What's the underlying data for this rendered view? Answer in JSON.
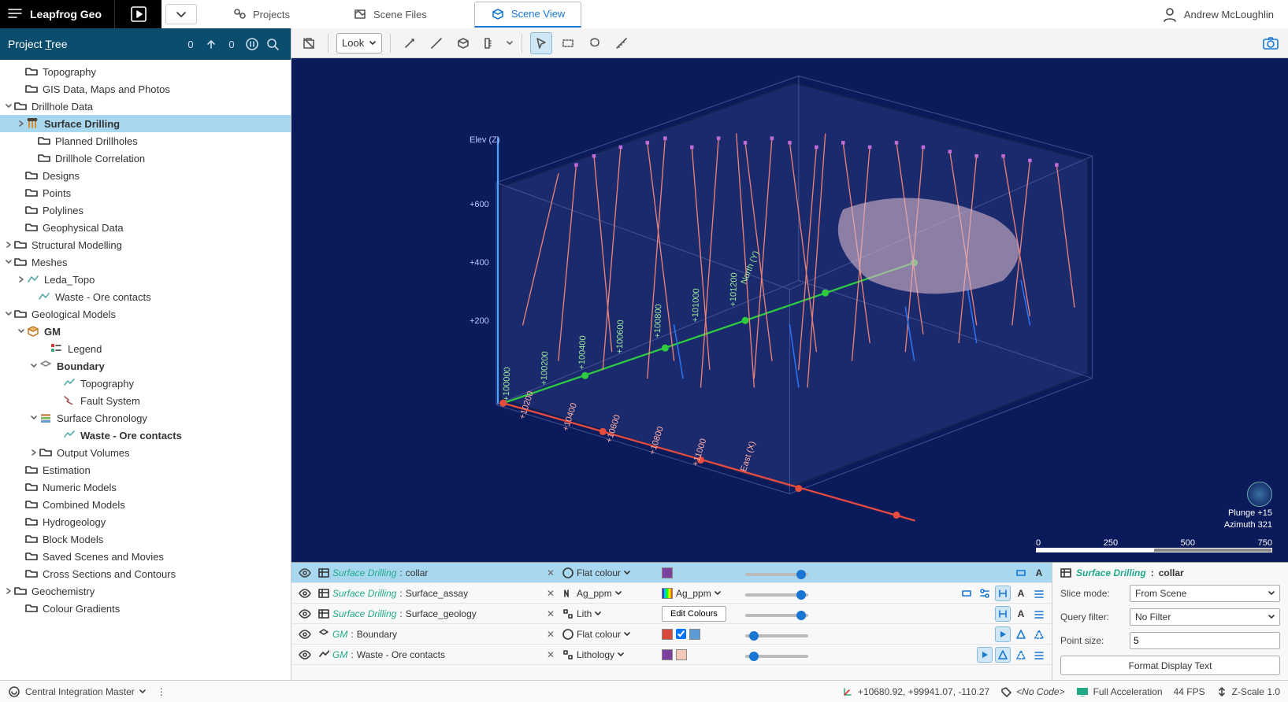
{
  "app": {
    "name": "Leapfrog Geo"
  },
  "user": "Andrew McLoughlin",
  "tabs": [
    {
      "label": "Projects"
    },
    {
      "label": "Scene Files"
    },
    {
      "label": "Scene View"
    }
  ],
  "sidebar": {
    "title_pre": "Project ",
    "title_u": "T",
    "title_post": "ree",
    "count_left": "0",
    "count_right": "0"
  },
  "tree": {
    "topography": "Topography",
    "gis": "GIS Data, Maps and Photos",
    "drillhole": "Drillhole Data",
    "surface_drilling": "Surface Drilling",
    "planned": "Planned Drillholes",
    "correlation": "Drillhole Correlation",
    "designs": "Designs",
    "points": "Points",
    "polylines": "Polylines",
    "geophys": "Geophysical Data",
    "structural": "Structural Modelling",
    "meshes": "Meshes",
    "leda_topo": "Leda_Topo",
    "waste_ore": "Waste - Ore contacts",
    "geomodels": "Geological Models",
    "gm": "GM",
    "legend": "Legend",
    "boundary": "Boundary",
    "gm_topography": "Topography",
    "fault_system": "Fault System",
    "surf_chron": "Surface Chronology",
    "waste_ore2": "Waste - Ore contacts",
    "output_vol": "Output Volumes",
    "estimation": "Estimation",
    "numeric_models": "Numeric Models",
    "combined_models": "Combined Models",
    "hydro": "Hydrogeology",
    "block_models": "Block Models",
    "saved_scenes": "Saved Scenes and Movies",
    "cross_sections": "Cross Sections and Contours",
    "geochem": "Geochemistry",
    "colour_grad": "Colour Gradients"
  },
  "toolbar": {
    "look": "Look"
  },
  "scene": {
    "elev_axis": "Elev (Z)",
    "east_axis": "East (X)",
    "north_axis": "North (Y)",
    "z_ticks": [
      "+200",
      "+400",
      "+600"
    ],
    "x_ticks": [
      "+10200",
      "+10400",
      "+10600",
      "+10800",
      "+11000"
    ],
    "y_ticks": [
      "+100000",
      "+100200",
      "+100400",
      "+100600",
      "+100800",
      "+101000",
      "+101200"
    ],
    "plunge": "Plunge +15",
    "azimuth": "Azimuth 321",
    "scale": {
      "t0": "0",
      "t1": "250",
      "t2": "500",
      "t3": "750"
    }
  },
  "scenelist": [
    {
      "src": "Surface Drilling",
      "name": "collar",
      "mode": "Flat colour",
      "sel": "",
      "swatch": "#7b3f9e",
      "slider": 95
    },
    {
      "src": "Surface Drilling",
      "name": "Surface_assay",
      "mode": "Ag_ppm",
      "sel": "Ag_ppm",
      "swatch": "grad",
      "slider": 95
    },
    {
      "src": "Surface Drilling",
      "name": "Surface_geology",
      "mode": "Lith",
      "sel": "Edit Colours",
      "swatch": "",
      "slider": 95
    },
    {
      "src": "GM",
      "name": "Boundary",
      "mode": "Flat colour",
      "sel": "",
      "swatch": "#d84b3a",
      "swatch2": "#5b9bd5",
      "slider": 8
    },
    {
      "src": "GM",
      "name": "Waste - Ore contacts",
      "mode": "Lithology",
      "sel": "",
      "swatch": "#7b3f9e",
      "swatch2": "#f5c7b8",
      "slider": 8
    }
  ],
  "props": {
    "header_src": "Surface Drilling",
    "header_name": "collar",
    "slice_label": "Slice mode:",
    "slice_value": "From Scene",
    "query_label": "Query filter:",
    "query_value": "No Filter",
    "pointsize_label": "Point size:",
    "pointsize_value": "5",
    "format_btn": "Format Display Text"
  },
  "status": {
    "central": "Central Integration Master",
    "coords": "+10680.92, +99941.07, -110.27",
    "nocode": "<No Code>",
    "accel": "Full Acceleration",
    "fps": "44 FPS",
    "zscale": "Z-Scale 1.0"
  }
}
